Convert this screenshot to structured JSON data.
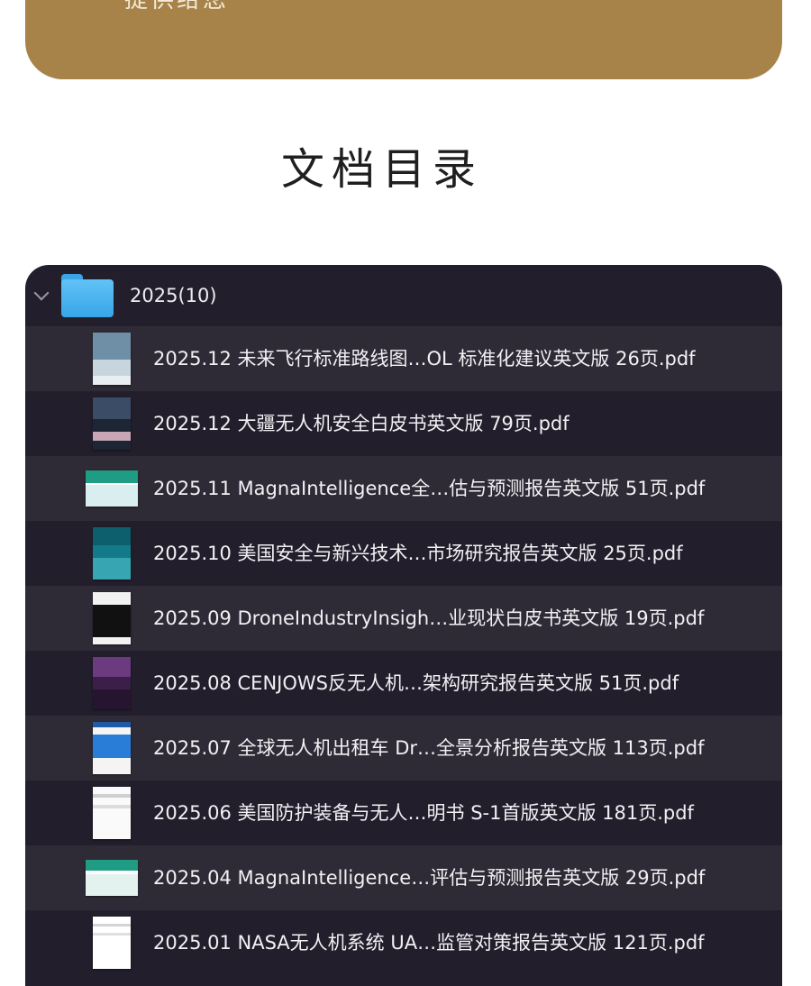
{
  "banner": {
    "text": "提供给您",
    "color": "#a7834a"
  },
  "page_title": "文档目录",
  "finder": {
    "folder": {
      "name": "2025(10)",
      "icon": "folder-icon",
      "expanded": true
    },
    "files": [
      {
        "name": "2025.12 未来飞行标准路线图…OL 标准化建议英文版 26页.pdf",
        "thumb": "report-cover"
      },
      {
        "name": "2025.12 大疆无人机安全白皮书英文版 79页.pdf",
        "thumb": "report-cover"
      },
      {
        "name": "2025.11 MagnaIntelligence全…估与预测报告英文版 51页.pdf",
        "thumb": "report-cover"
      },
      {
        "name": "2025.10 美国安全与新兴技术…市场研究报告英文版 25页.pdf",
        "thumb": "report-cover"
      },
      {
        "name": "2025.09 DroneIndustryInsigh…业现状白皮书英文版 19页.pdf",
        "thumb": "report-cover"
      },
      {
        "name": "2025.08 CENJOWS反无人机…架构研究报告英文版 51页.pdf",
        "thumb": "report-cover"
      },
      {
        "name": "2025.07 全球无人机出租车 Dr…全景分析报告英文版 113页.pdf",
        "thumb": "report-cover"
      },
      {
        "name": "2025.06 美国防护装备与无人…明书 S-1首版英文版 181页.pdf",
        "thumb": "report-cover"
      },
      {
        "name": "2025.04 MagnaIntelligence…评估与预测报告英文版 29页.pdf",
        "thumb": "report-cover"
      },
      {
        "name": "2025.01 NASA无人机系统 UA…监管对策报告英文版 121页.pdf",
        "thumb": "report-cover"
      }
    ]
  },
  "colors": {
    "banner": "#a7834a",
    "panel_bg": "#231e2c",
    "row_alt": "#2f2b36",
    "folder_blue": "#4db4f0",
    "text": "#f1f1f4"
  }
}
